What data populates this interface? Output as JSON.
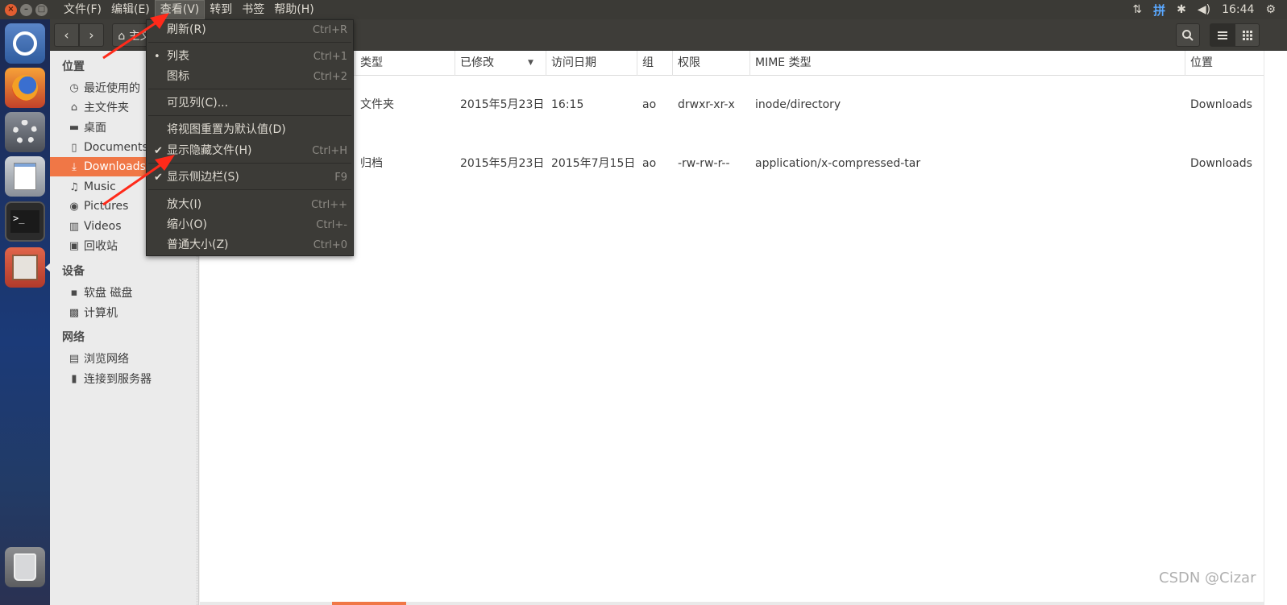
{
  "window_controls": {
    "close": "×",
    "minimize": "–",
    "maximize": "□"
  },
  "menubar": [
    {
      "label": "文件(F)"
    },
    {
      "label": "编辑(E)"
    },
    {
      "label": "查看(V)"
    },
    {
      "label": "转到"
    },
    {
      "label": "书签"
    },
    {
      "label": "帮助(H)"
    }
  ],
  "indicators": {
    "network": "⇅",
    "ime": "拼",
    "bluetooth": "✱",
    "volume": "◀)",
    "time": "16:44",
    "settings": "⚙"
  },
  "toolbar": {
    "home_label": "⌂ 主文"
  },
  "sidebar": {
    "sections": [
      {
        "title": "位置"
      },
      {
        "title": "设备"
      },
      {
        "title": "网络"
      }
    ],
    "items": [
      {
        "icon": "clock-icon",
        "glyph": "◷",
        "label": "最近使用的"
      },
      {
        "icon": "home-icon",
        "glyph": "⌂",
        "label": "主文件夹"
      },
      {
        "icon": "folder-icon",
        "glyph": "▬",
        "label": "桌面"
      },
      {
        "icon": "document-icon",
        "glyph": "▯",
        "label": "Documents"
      },
      {
        "icon": "download-icon",
        "glyph": "⤓",
        "label": "Downloads"
      },
      {
        "icon": "music-icon",
        "glyph": "♫",
        "label": "Music"
      },
      {
        "icon": "camera-icon",
        "glyph": "◉",
        "label": "Pictures"
      },
      {
        "icon": "film-icon",
        "glyph": "▥",
        "label": "Videos"
      },
      {
        "icon": "trash-icon",
        "glyph": "▣",
        "label": "回收站"
      },
      {
        "icon": "floppy-icon",
        "glyph": "▪",
        "label": "软盘 磁盘"
      },
      {
        "icon": "computer-icon",
        "glyph": "▩",
        "label": "计算机"
      },
      {
        "icon": "network-icon",
        "glyph": "▤",
        "label": "浏览网络"
      },
      {
        "icon": "server-icon",
        "glyph": "▮",
        "label": "连接到服务器"
      }
    ]
  },
  "columns": [
    "类型",
    "已修改",
    "访问日期",
    "组",
    "权限",
    "MIME 类型",
    "位置"
  ],
  "rows": [
    {
      "type": "文件夹",
      "modified": "2015年5月23日",
      "accessed": "16:15",
      "group": "ao",
      "permissions": "drwxr-xr-x",
      "mime": "inode/directory",
      "location": "Downloads"
    },
    {
      "type": "归档",
      "modified": "2015年5月23日",
      "accessed": "2015年7月15日",
      "group": "ao",
      "permissions": "-rw-rw-r--",
      "mime": "application/x-compressed-tar",
      "location": "Downloads"
    }
  ],
  "view_menu": [
    {
      "label": "刷新(R)",
      "accel": "Ctrl+R",
      "mark": ""
    },
    {
      "label": "列表",
      "accel": "Ctrl+1",
      "mark": "•"
    },
    {
      "label": "图标",
      "accel": "Ctrl+2",
      "mark": ""
    },
    {
      "label": "可见列(C)...",
      "accel": "",
      "mark": ""
    },
    {
      "label": "将视图重置为默认值(D)",
      "accel": "",
      "mark": ""
    },
    {
      "label": "显示隐藏文件(H)",
      "accel": "Ctrl+H",
      "mark": "✔"
    },
    {
      "label": "显示侧边栏(S)",
      "accel": "F9",
      "mark": "✔"
    },
    {
      "label": "放大(I)",
      "accel": "Ctrl++",
      "mark": ""
    },
    {
      "label": "缩小(O)",
      "accel": "Ctrl+-",
      "mark": ""
    },
    {
      "label": "普通大小(Z)",
      "accel": "Ctrl+0",
      "mark": ""
    }
  ],
  "watermark": "CSDN @Cizar",
  "colors": {
    "accent": "#f07746",
    "annotation_arrow": "#ff2a1a",
    "panel": "#3b3a36"
  }
}
